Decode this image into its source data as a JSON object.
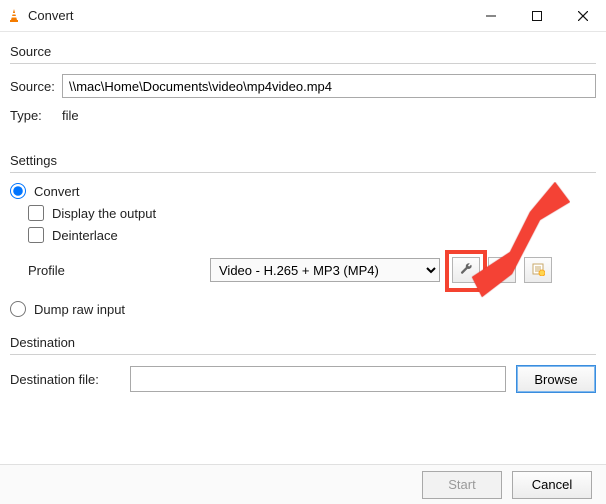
{
  "window": {
    "title": "Convert"
  },
  "source": {
    "section_label": "Source",
    "source_label": "Source:",
    "source_value": "\\\\mac\\Home\\Documents\\video\\mp4video.mp4",
    "type_label": "Type:",
    "type_value": "file"
  },
  "settings": {
    "section_label": "Settings",
    "convert_label": "Convert",
    "display_output_label": "Display the output",
    "deinterlace_label": "Deinterlace",
    "profile_label": "Profile",
    "profile_selected": "Video - H.265 + MP3 (MP4)",
    "dump_raw_label": "Dump raw input"
  },
  "destination": {
    "section_label": "Destination",
    "file_label": "Destination file:",
    "file_value": "",
    "browse_label": "Browse"
  },
  "footer": {
    "start_label": "Start",
    "cancel_label": "Cancel"
  },
  "icons": {
    "app": "vlc-cone-icon",
    "wrench": "wrench-icon",
    "delete": "delete-icon",
    "new": "new-profile-icon"
  }
}
